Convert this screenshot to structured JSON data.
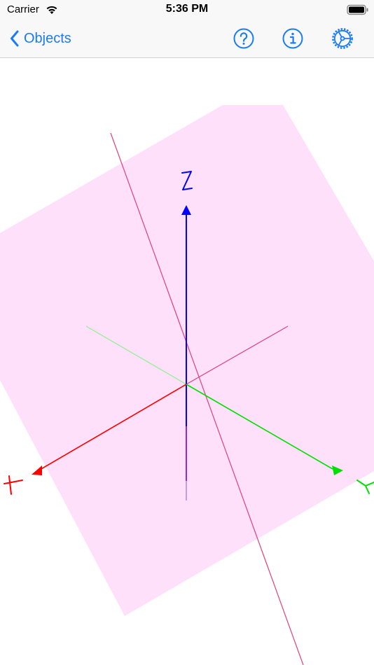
{
  "status": {
    "carrier": "Carrier",
    "time": "5:36 PM",
    "battery_level": 1.0
  },
  "nav": {
    "back_label": "Objects",
    "icons": [
      "help-icon",
      "info-icon",
      "settings-icon"
    ],
    "accent_color": "#1a7cf5"
  },
  "scene": {
    "axis_labels": {
      "x": "X",
      "y": "Y",
      "z": "Z"
    },
    "colors": {
      "x_axis": "#ff0000",
      "y_axis": "#00e000",
      "z_axis": "#0000ff",
      "plane": "#ffe0fb",
      "line": "#e0407a"
    }
  }
}
